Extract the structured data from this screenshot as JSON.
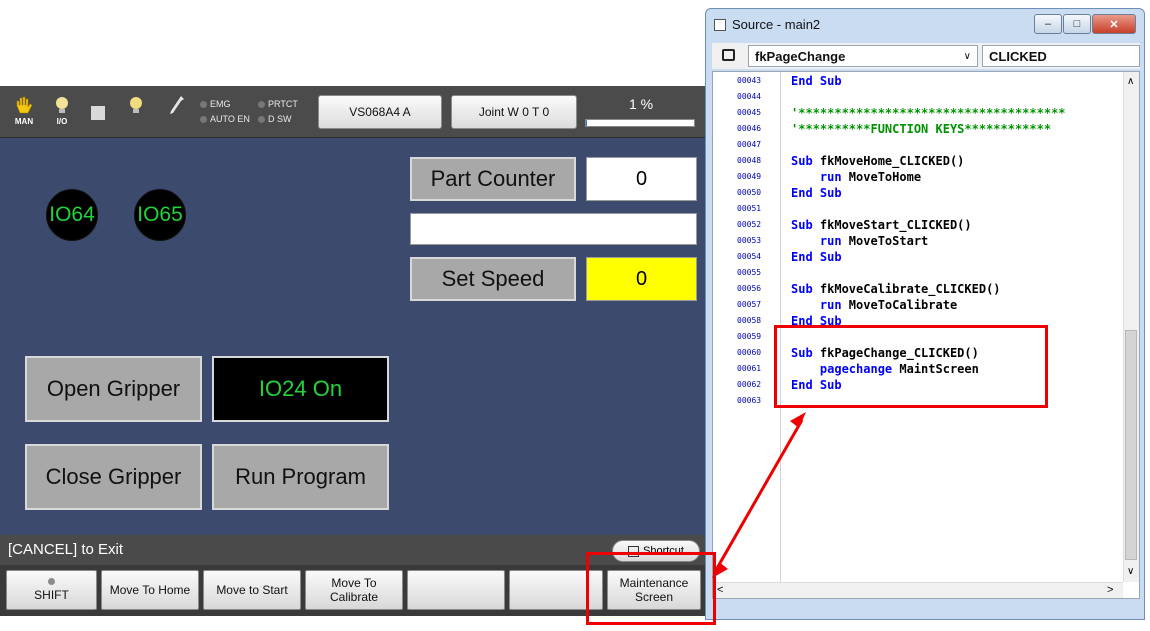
{
  "pendant": {
    "status": {
      "man_label": "MAN",
      "io_label": "I/O",
      "emg": "EMG",
      "prtct": "PRTCT",
      "auto_en": "AUTO EN",
      "d_sw": "D SW",
      "robot_button": "VS068A4 A",
      "joint_button": "Joint  W 0 T 0",
      "speed_pct": "1 %",
      "speed_fraction": 0.01
    },
    "io": [
      "IO64",
      "IO65"
    ],
    "part_counter": {
      "label": "Part Counter",
      "value": "0"
    },
    "empty_field": "",
    "set_speed": {
      "label": "Set Speed",
      "value": "0"
    },
    "buttons": {
      "open_gripper": "Open Gripper",
      "io24": "IO24 On",
      "close_gripper": "Close Gripper",
      "run_program": "Run Program"
    },
    "cancel_text": "[CANCEL] to Exit",
    "shortcut": "Shortcut",
    "fkeys": [
      "SHIFT",
      "Move To Home",
      "Move to Start",
      "Move To Calibrate",
      "",
      "",
      "Maintenance Screen"
    ]
  },
  "source": {
    "title": "Source - main2",
    "object_combo": "fkPageChange",
    "event_combo": "CLICKED",
    "lines": [
      {
        "n": "00043",
        "parts": [
          [
            "kw",
            "End Sub"
          ]
        ]
      },
      {
        "n": "00044",
        "parts": []
      },
      {
        "n": "00045",
        "parts": [
          [
            "cmt",
            "'*************************************"
          ]
        ]
      },
      {
        "n": "00046",
        "parts": [
          [
            "cmt",
            "'**********FUNCTION KEYS************"
          ]
        ]
      },
      {
        "n": "00047",
        "parts": []
      },
      {
        "n": "00048",
        "parts": [
          [
            "kw",
            "Sub "
          ],
          [
            "idn",
            "fkMoveHome_CLICKED()"
          ]
        ]
      },
      {
        "n": "00049",
        "parts": [
          [
            "kw",
            "    run "
          ],
          [
            "idn",
            "MoveToHome"
          ]
        ]
      },
      {
        "n": "00050",
        "parts": [
          [
            "kw",
            "End Sub"
          ]
        ]
      },
      {
        "n": "00051",
        "parts": []
      },
      {
        "n": "00052",
        "parts": [
          [
            "kw",
            "Sub "
          ],
          [
            "idn",
            "fkMoveStart_CLICKED()"
          ]
        ]
      },
      {
        "n": "00053",
        "parts": [
          [
            "kw",
            "    run "
          ],
          [
            "idn",
            "MoveToStart"
          ]
        ]
      },
      {
        "n": "00054",
        "parts": [
          [
            "kw",
            "End Sub"
          ]
        ]
      },
      {
        "n": "00055",
        "parts": []
      },
      {
        "n": "00056",
        "parts": [
          [
            "kw",
            "Sub "
          ],
          [
            "idn",
            "fkMoveCalibrate_CLICKED()"
          ]
        ]
      },
      {
        "n": "00057",
        "parts": [
          [
            "kw",
            "    run "
          ],
          [
            "idn",
            "MoveToCalibrate"
          ]
        ]
      },
      {
        "n": "00058",
        "parts": [
          [
            "kw",
            "End Sub"
          ]
        ]
      },
      {
        "n": "00059",
        "parts": []
      },
      {
        "n": "00060",
        "parts": [
          [
            "kw",
            "Sub "
          ],
          [
            "idn",
            "fkPageChange_CLICKED()"
          ]
        ]
      },
      {
        "n": "00061",
        "parts": [
          [
            "kw",
            "    pagechange "
          ],
          [
            "idn",
            "MaintScreen"
          ]
        ]
      },
      {
        "n": "00062",
        "parts": [
          [
            "kw",
            "End Sub"
          ]
        ]
      },
      {
        "n": "00063",
        "parts": []
      }
    ]
  },
  "colors": {
    "accent_red": "#ee0000",
    "io_green": "#22d33b",
    "speed_yellow": "#ffff00"
  }
}
